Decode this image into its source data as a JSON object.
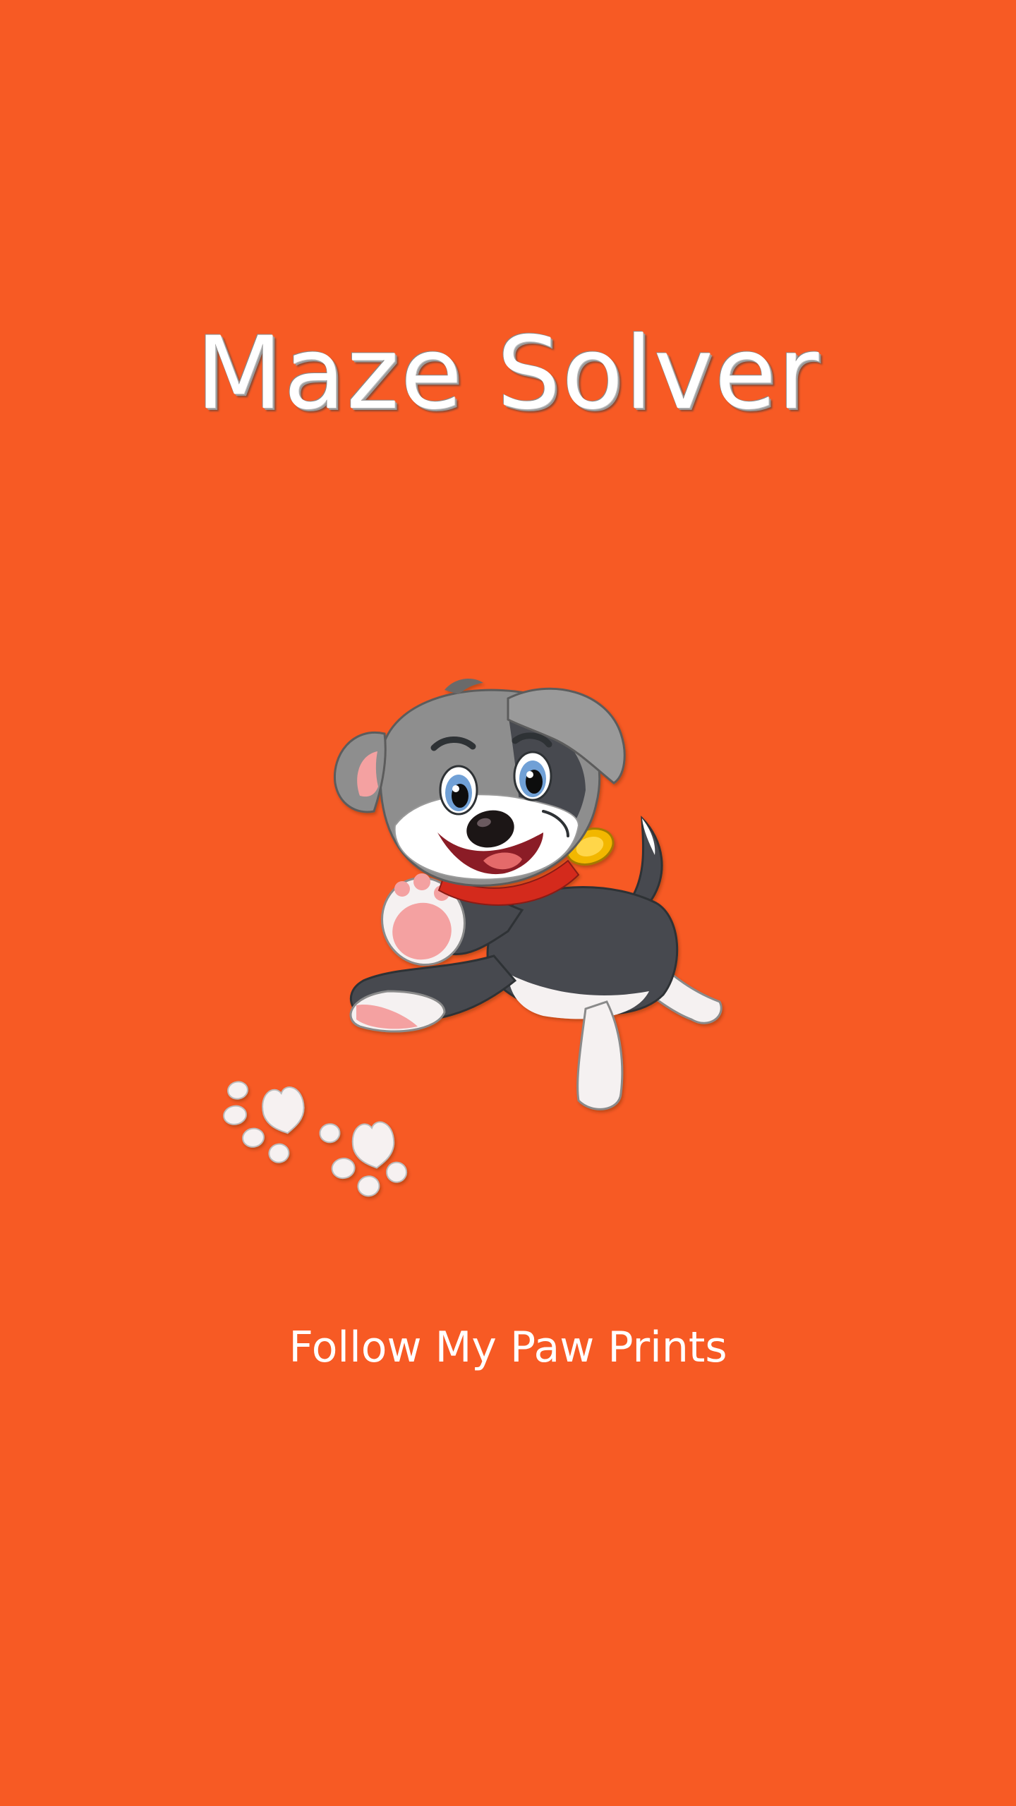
{
  "splash": {
    "title": "Maze Solver",
    "tagline": "Follow My Paw Prints",
    "mascot_icon": "puppy-mascot-icon",
    "paw_icon": "paw-print-icon"
  },
  "colors": {
    "background": "#F75A24",
    "text": "#FFFFFF",
    "dog_gray": "#8E8E8E",
    "dog_dark": "#474A50",
    "collar": "#D42A1E",
    "tag": "#F2B705",
    "paw_pad": "#F4A1A1"
  }
}
